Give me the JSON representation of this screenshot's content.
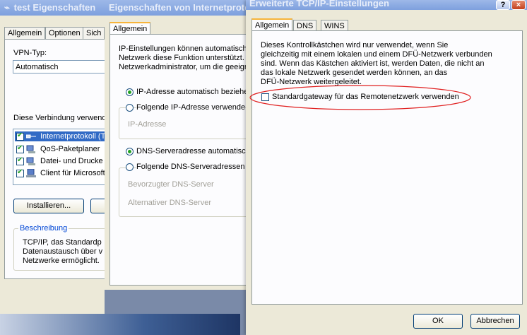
{
  "windows": {
    "back": {
      "title": "test Eigenschaften",
      "tabs": [
        "Allgemein",
        "Optionen",
        "Sich"
      ],
      "vpn_label": "VPN-Typ:",
      "vpn_value": "Automatisch",
      "components_label": "Diese Verbindung verwende",
      "components": [
        {
          "label": "Internetprotokoll (T",
          "checked": true,
          "icon": "network-protocol-icon"
        },
        {
          "label": "QoS-Paketplaner",
          "checked": true,
          "icon": "network-service-icon"
        },
        {
          "label": "Datei- und Drucke",
          "checked": true,
          "icon": "network-service-icon"
        },
        {
          "label": "Client für Microsoft",
          "checked": true,
          "icon": "network-client-icon"
        }
      ],
      "install_button": "Installieren...",
      "description_legend": "Beschreibung",
      "description_lines": [
        "TCP/IP, das Standardp",
        "Datenaustausch über v",
        "Netzwerke ermöglicht."
      ]
    },
    "middle": {
      "title": "Eigenschaften von Internetproto",
      "tab": "Allgemein",
      "intro_lines": [
        "IP-Einstellungen können automatisch",
        "Netzwerk diese Funktion unterstützt. V",
        "Netzwerkadministrator, um die geeign"
      ],
      "ip_auto": "IP-Adresse automatisch beziehe",
      "ip_manual": "Folgende IP-Adresse verwende",
      "ip_address_label": "IP-Adresse",
      "dns_auto": "DNS-Serveradresse automatisch",
      "dns_manual": "Folgende DNS-Serveradressen v",
      "dns_preferred": "Bevorzugter DNS-Server",
      "dns_alternate": "Alternativer DNS-Server"
    },
    "front": {
      "title": "Erweiterte TCP/IP-Einstellungen",
      "help_button": "?",
      "close_button": "×",
      "tabs": [
        "Allgemein",
        "DNS",
        "WINS"
      ],
      "description_lines": [
        "Dieses Kontrollkästchen wird nur verwendet, wenn Sie",
        "gleichzeitig mit einem lokalen und einem DFÜ-Netzwerk verbunden",
        "sind. Wenn das Kästchen aktiviert ist, werden Daten, die nicht an",
        "das lokale Netzwerk gesendet werden können, an das",
        "DFÜ-Netzwerk weitergeleitet."
      ],
      "gateway_checkbox": "Standardgateway für das Remotenetzwerk verwenden",
      "ok_button": "OK",
      "cancel_button": "Abbrechen"
    }
  },
  "colors": {
    "highlight_ellipse": "#e02020",
    "xp_face": "#ece9d8",
    "tab_accent": "#f7b43a"
  }
}
